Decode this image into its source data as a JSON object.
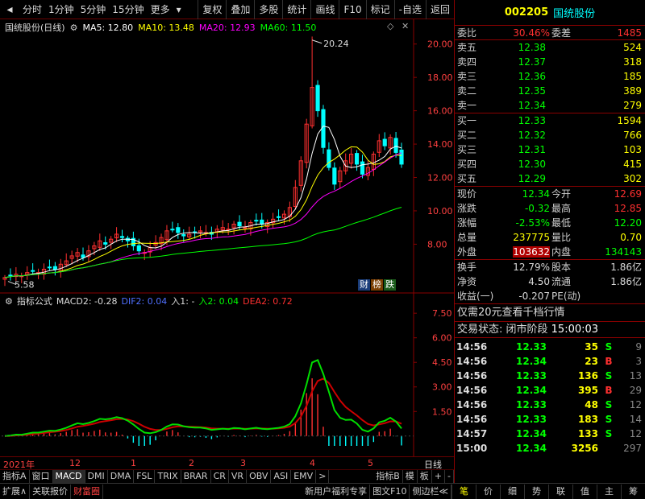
{
  "toolbar": {
    "tabs": [
      "分时",
      "1分钟",
      "5分钟",
      "15分钟",
      "更多"
    ],
    "tools": [
      "复权",
      "叠加",
      "多股",
      "统计",
      "画线",
      "F10",
      "标记",
      "-自选",
      "返回"
    ]
  },
  "chart_header": {
    "name": "国统股份(日线)",
    "ma5": "MA5: 12.80",
    "ma10": "MA10: 13.48",
    "ma20": "MA20: 12.93",
    "ma60": "MA60: 11.50"
  },
  "indicator_header": {
    "name": "指标公式",
    "macd": "MACD2: -0.28",
    "dif": "DIF2: 0.04",
    "in1": "入1: -",
    "in2": "入2: 0.04",
    "dea": "DEA2: 0.72"
  },
  "badges": [
    "财",
    "榜",
    "跌"
  ],
  "chart_data": [
    {
      "type": "candlestick",
      "title": "国统股份(日线)",
      "y_axis_ticks": [
        20.0,
        18.0,
        16.0,
        14.0,
        12.0,
        10.0,
        8.0
      ],
      "ylim": [
        5.8,
        21.0
      ],
      "high_label": "20.24",
      "low_label": "5.58",
      "series": [
        {
          "name": "MA5",
          "color": "#ffffff"
        },
        {
          "name": "MA10",
          "color": "#ffff00"
        },
        {
          "name": "MA20",
          "color": "#ff00ff"
        },
        {
          "name": "MA60",
          "color": "#00ff00"
        }
      ],
      "close": [
        6.0,
        6.1,
        6.2,
        6.1,
        6.3,
        6.4,
        6.3,
        6.5,
        6.6,
        6.5,
        6.8,
        7.0,
        7.3,
        7.5,
        7.2,
        7.6,
        7.9,
        8.2,
        8.0,
        8.3,
        8.6,
        8.4,
        8.2,
        7.9,
        7.6,
        7.5,
        7.8,
        8.1,
        8.4,
        8.8,
        8.9,
        8.7,
        8.5,
        8.6,
        8.7,
        8.8,
        8.7,
        8.6,
        8.9,
        9.0,
        8.9,
        9.2,
        9.1,
        9.0,
        9.3,
        9.4,
        9.2,
        9.3,
        9.5,
        9.6,
        9.8,
        10.2,
        11.4,
        13.0,
        15.2,
        17.4,
        16.0,
        13.8,
        12.6,
        11.6,
        12.4,
        13.0,
        13.4,
        12.8,
        12.2,
        12.6,
        13.4,
        14.2,
        13.9,
        14.4,
        13.5,
        12.8
      ]
    },
    {
      "type": "bar",
      "title": "MACD2",
      "y_axis_ticks": [
        7.5,
        6.0,
        4.5,
        3.0,
        1.5
      ],
      "ylim": [
        -0.6,
        8.0
      ]
    }
  ],
  "timeline": {
    "labels": [
      "2021年",
      "12",
      "1",
      "2",
      "3",
      "4",
      "5"
    ],
    "period": "日线"
  },
  "bottom_tabs": [
    "指标A",
    "窗口",
    "MACD",
    "DMI",
    "DMA",
    "FSL",
    "TRIX",
    "BRAR",
    "CR",
    "VR",
    "OBV",
    "ASI",
    "EMV",
    ">",
    "指标B",
    "模",
    "板",
    "+",
    "-"
  ],
  "footer": {
    "items": [
      "扩展∧",
      "关联报价",
      "财富圈"
    ],
    "promo": "新用户福利专享",
    "right_items": [
      "图文F10",
      "侧边栏≪"
    ],
    "nav": [
      "笔",
      "价",
      "细",
      "势",
      "联",
      "值",
      "主",
      "筹"
    ]
  },
  "quote": {
    "code": "002205",
    "name": "国统股份",
    "weibi_label": "委比",
    "weibi": "30.46%",
    "weicha_label": "委差",
    "weicha": "1485",
    "sells": [
      {
        "label": "卖五",
        "price": "12.38",
        "vol": "524"
      },
      {
        "label": "卖四",
        "price": "12.37",
        "vol": "318"
      },
      {
        "label": "卖三",
        "price": "12.36",
        "vol": "185"
      },
      {
        "label": "卖二",
        "price": "12.35",
        "vol": "389"
      },
      {
        "label": "卖一",
        "price": "12.34",
        "vol": "279"
      }
    ],
    "buys": [
      {
        "label": "买一",
        "price": "12.33",
        "vol": "1594"
      },
      {
        "label": "买二",
        "price": "12.32",
        "vol": "766"
      },
      {
        "label": "买三",
        "price": "12.31",
        "vol": "103"
      },
      {
        "label": "买四",
        "price": "12.30",
        "vol": "415"
      },
      {
        "label": "买五",
        "price": "12.29",
        "vol": "302"
      }
    ],
    "stats": [
      {
        "l1": "现价",
        "v1": "12.34",
        "l2": "今开",
        "v2": "12.69"
      },
      {
        "l1": "涨跌",
        "v1": "-0.32",
        "l2": "最高",
        "v2": "12.85"
      },
      {
        "l1": "涨幅",
        "v1": "-2.53%",
        "l2": "最低",
        "v2": "12.20"
      },
      {
        "l1": "总量",
        "v1": "237775",
        "l2": "量比",
        "v2": "0.70"
      },
      {
        "l1": "外盘",
        "v1": "103632",
        "l2": "内盘",
        "v2": "134143"
      }
    ],
    "finance": [
      {
        "l1": "换手",
        "v1": "12.79%",
        "l2": "股本",
        "v2": "1.86亿"
      },
      {
        "l1": "净资",
        "v1": "4.50",
        "l2": "流通",
        "v2": "1.86亿"
      },
      {
        "l1": "收益(一)",
        "v1": "-0.207",
        "l2": "PE(动)",
        "v2": ""
      }
    ],
    "promo": "仅需20元查看千档行情",
    "status_label": "交易状态: 闭市阶段",
    "status_time": "15:00:03",
    "ticks": [
      {
        "t": "14:56",
        "p": "12.33",
        "v": "35",
        "s": "S",
        "n": "9"
      },
      {
        "t": "14:56",
        "p": "12.34",
        "v": "23",
        "s": "B",
        "n": "3"
      },
      {
        "t": "14:56",
        "p": "12.33",
        "v": "136",
        "s": "S",
        "n": "13"
      },
      {
        "t": "14:56",
        "p": "12.34",
        "v": "395",
        "s": "B",
        "n": "29"
      },
      {
        "t": "14:56",
        "p": "12.33",
        "v": "48",
        "s": "S",
        "n": "12"
      },
      {
        "t": "14:56",
        "p": "12.33",
        "v": "183",
        "s": "S",
        "n": "14"
      },
      {
        "t": "14:57",
        "p": "12.34",
        "v": "133",
        "s": "S",
        "n": "12"
      },
      {
        "t": "15:00",
        "p": "12.34",
        "v": "3256",
        "s": "",
        "n": "297"
      }
    ]
  }
}
